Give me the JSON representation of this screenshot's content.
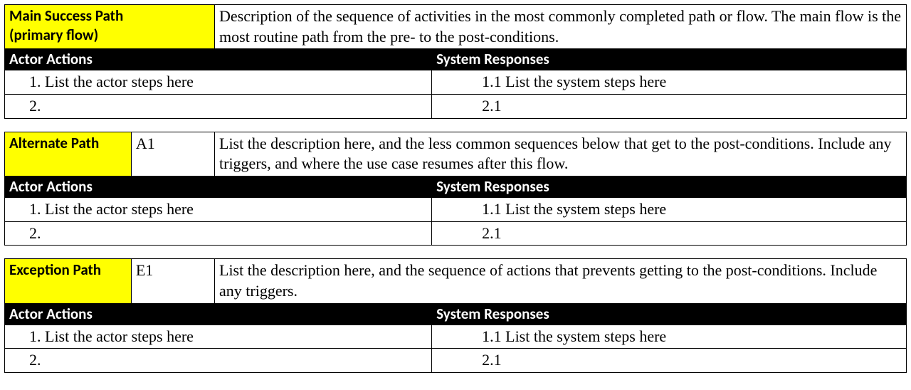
{
  "main": {
    "title_line1": "Main Success Path",
    "title_line2": "(primary flow)",
    "description": "Description of the sequence of activities in the most commonly completed path or flow. The main flow is the most routine path from the pre- to the post-conditions.",
    "actor_header": "Actor Actions",
    "system_header": "System Responses",
    "actor_steps": {
      "s1": "1.   List the actor steps here",
      "s2": "2."
    },
    "system_steps": {
      "s1": "1.1 List the system steps here",
      "s2": "2.1"
    }
  },
  "alternate": {
    "title": "Alternate Path",
    "code": "A1",
    "description": "List the description here, and the less common sequences below that get to the post-conditions. Include any triggers, and where the use case resumes after this flow.",
    "actor_header": "Actor Actions",
    "system_header": "System Responses",
    "actor_steps": {
      "s1": "1.   List the actor steps here",
      "s2": "2."
    },
    "system_steps": {
      "s1": "1.1 List the system steps here",
      "s2": "2.1"
    }
  },
  "exception": {
    "title": "Exception Path",
    "code": "E1",
    "description": "List the description here, and the sequence of actions that prevents getting to the post-conditions. Include any triggers.",
    "actor_header": "Actor Actions",
    "system_header": "System Responses",
    "actor_steps": {
      "s1": "1.   List the actor steps here",
      "s2": "2."
    },
    "system_steps": {
      "s1": "1.1 List the system steps here",
      "s2": "2.1"
    }
  }
}
